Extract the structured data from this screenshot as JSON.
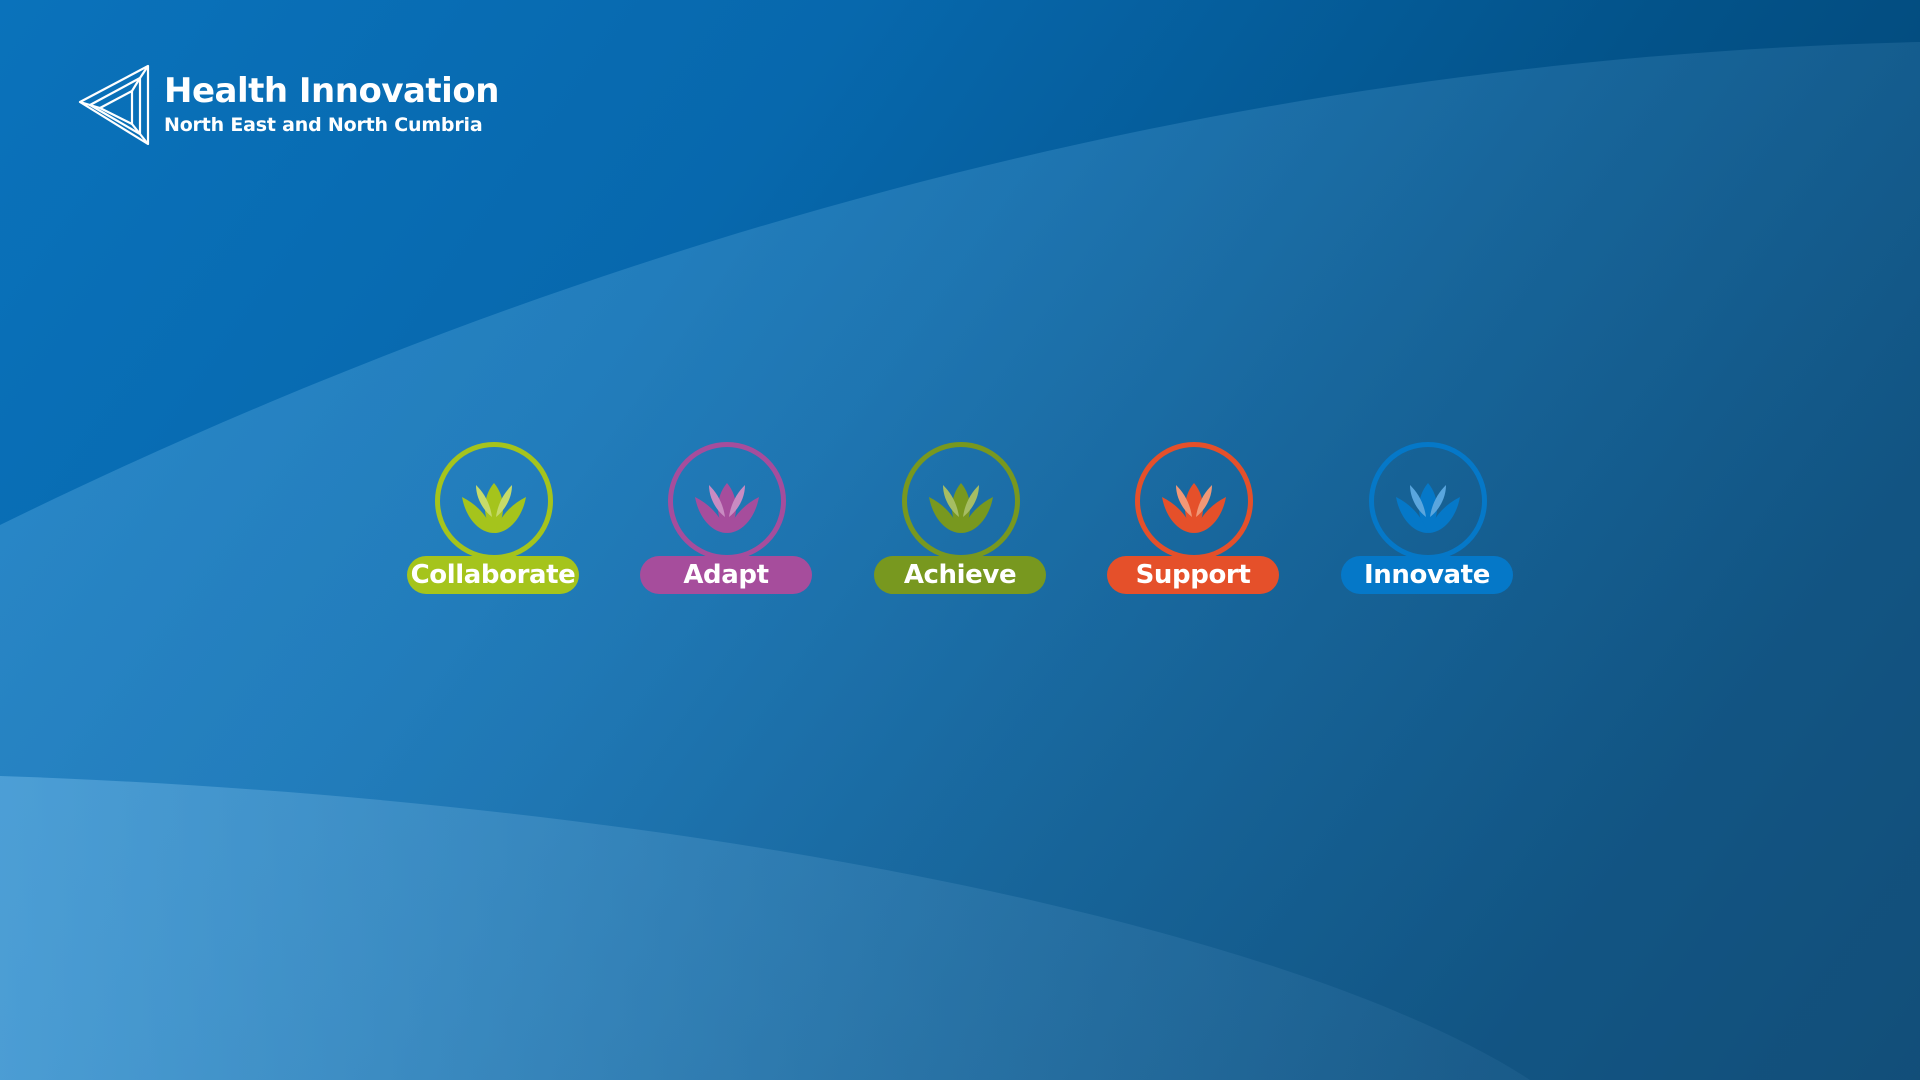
{
  "logo": {
    "title": "Health Innovation",
    "subtitle": "North East and North Cumbria",
    "mark_icon": "impossible-triangle-logo-icon"
  },
  "values": [
    {
      "label": "Collaborate",
      "color": "#a5c41c",
      "icon": "lotus-icon"
    },
    {
      "label": "Adapt",
      "color": "#a64d9c",
      "icon": "lotus-icon"
    },
    {
      "label": "Achieve",
      "color": "#78981f",
      "icon": "lotus-icon"
    },
    {
      "label": "Support",
      "color": "#e5502a",
      "icon": "lotus-icon"
    },
    {
      "label": "Innovate",
      "color": "#0578c8",
      "icon": "lotus-icon"
    }
  ],
  "colors": {
    "background_start": "#0a72bb",
    "background_end": "#033e68",
    "text": "#ffffff"
  }
}
